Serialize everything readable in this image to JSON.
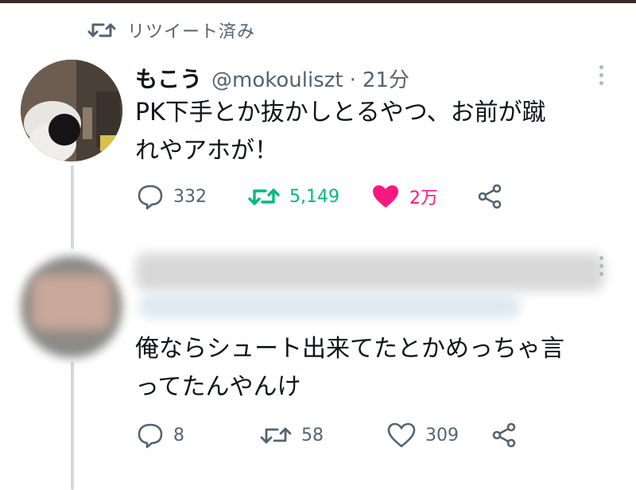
{
  "retweet_banner": {
    "label": "リツイート済み",
    "icon": "retweet-icon"
  },
  "tweet1": {
    "name": "もこう",
    "handle": "@mokouliszt",
    "separator": "·",
    "time": "21分",
    "text": "PK下手とか抜かしとるやつ、お前が蹴\nれやアホが！",
    "replies": "332",
    "retweets": "5,149",
    "likes": "2万",
    "retweeted": true,
    "liked": true
  },
  "tweet2": {
    "text": "俺ならシュート出来てたとかめっちゃ言\nってたんやんけ",
    "replies": "8",
    "retweets": "58",
    "likes": "309"
  },
  "colors": {
    "secondary_text": "#536471",
    "retweet_green": "#00ba7c",
    "like_pink": "#f91880",
    "thread_line": "#cfd9de"
  }
}
